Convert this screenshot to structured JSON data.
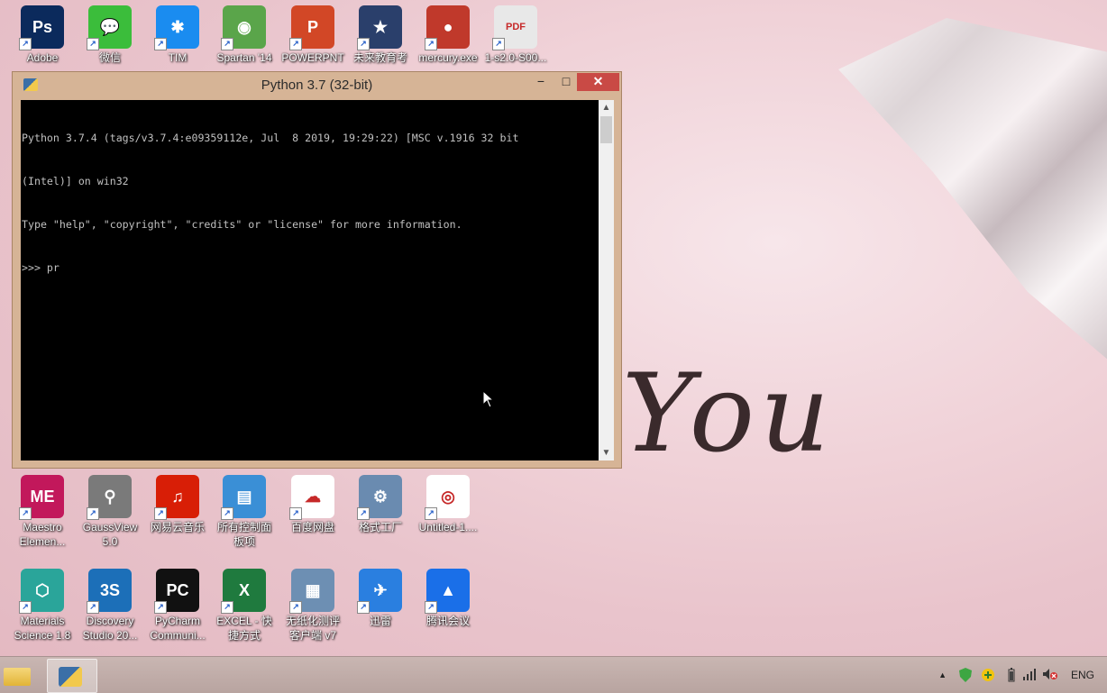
{
  "desktop": {
    "icons_row1": [
      {
        "name": "adobe-photoshop-icon",
        "label": "Adobe",
        "color": "#0b2a5c",
        "glyph": "Ps"
      },
      {
        "name": "wechat-icon",
        "label": "微信",
        "color": "#3bbd3b",
        "glyph": "💬"
      },
      {
        "name": "tim-icon",
        "label": "TIM",
        "color": "#1a8cf0",
        "glyph": "✱"
      },
      {
        "name": "spartan-icon",
        "label": "Spartan '14",
        "color": "#5aa54a",
        "glyph": "◉"
      },
      {
        "name": "powerpoint-icon",
        "label": "POWERPNT",
        "color": "#d24726",
        "glyph": "P"
      },
      {
        "name": "future-education-icon",
        "label": "未来教育考",
        "color": "#2a3f6b",
        "glyph": "★"
      },
      {
        "name": "mercury-icon",
        "label": "mercury.exe",
        "color": "#c0392b",
        "glyph": "●"
      },
      {
        "name": "pdf-icon",
        "label": "1-s2.0-S00...",
        "color": "#e8e8e8",
        "glyph": "PDF"
      }
    ],
    "icons_row2": [
      {
        "name": "maestro-icon",
        "label": "Maestro\nElemen...",
        "color": "#c2185b",
        "glyph": "ME"
      },
      {
        "name": "gaussview-icon",
        "label": "GaussView\n5.0",
        "color": "#7a7a7a",
        "glyph": "⚲"
      },
      {
        "name": "netease-music-icon",
        "label": "网易云音乐",
        "color": "#d81e06",
        "glyph": "♫"
      },
      {
        "name": "control-panel-icon",
        "label": "所有控制面\n板项",
        "color": "#3a8fd6",
        "glyph": "▤"
      },
      {
        "name": "baidu-netdisk-icon",
        "label": "百度网盘",
        "color": "#ffffff",
        "glyph": "☁"
      },
      {
        "name": "format-factory-icon",
        "label": "格式工厂",
        "color": "#6a8bb0",
        "glyph": "⚙"
      },
      {
        "name": "chrome-icon",
        "label": "Untitled-1....",
        "color": "#ffffff",
        "glyph": "◎"
      }
    ],
    "icons_row3": [
      {
        "name": "materials-studio-icon",
        "label": "Materials\nScience 1.8",
        "color": "#2aa59a",
        "glyph": "⬡"
      },
      {
        "name": "discovery-studio-icon",
        "label": "Discovery\nStudio 20...",
        "color": "#1c6fb8",
        "glyph": "3S"
      },
      {
        "name": "pycharm-icon",
        "label": "PyCharm\nCommuni...",
        "color": "#111111",
        "glyph": "PC"
      },
      {
        "name": "excel-icon",
        "label": "EXCEL - 快\n捷方式",
        "color": "#1f7a3e",
        "glyph": "X"
      },
      {
        "name": "paperless-eval-icon",
        "label": "无纸化测评\n客户端 v7",
        "color": "#6d8fb3",
        "glyph": "▦"
      },
      {
        "name": "xunlei-icon",
        "label": "迅雷",
        "color": "#2a7fe0",
        "glyph": "✈"
      },
      {
        "name": "tencent-meeting-icon",
        "label": "腾讯会议",
        "color": "#1a6fe8",
        "glyph": "▲"
      }
    ],
    "wallpaper_text": "You"
  },
  "python_window": {
    "title": "Python 3.7 (32-bit)",
    "min_label": "−",
    "max_label": "□",
    "close_label": "✕",
    "console_lines": [
      "Python 3.7.4 (tags/v3.7.4:e09359112e, Jul  8 2019, 19:29:22) [MSC v.1916 32 bit",
      "(Intel)] on win32",
      "Type \"help\", \"copyright\", \"credits\" or \"license\" for more information.",
      ">>> pr"
    ]
  },
  "taskbar": {
    "tray_arrow": "▲",
    "lang": "ENG"
  }
}
